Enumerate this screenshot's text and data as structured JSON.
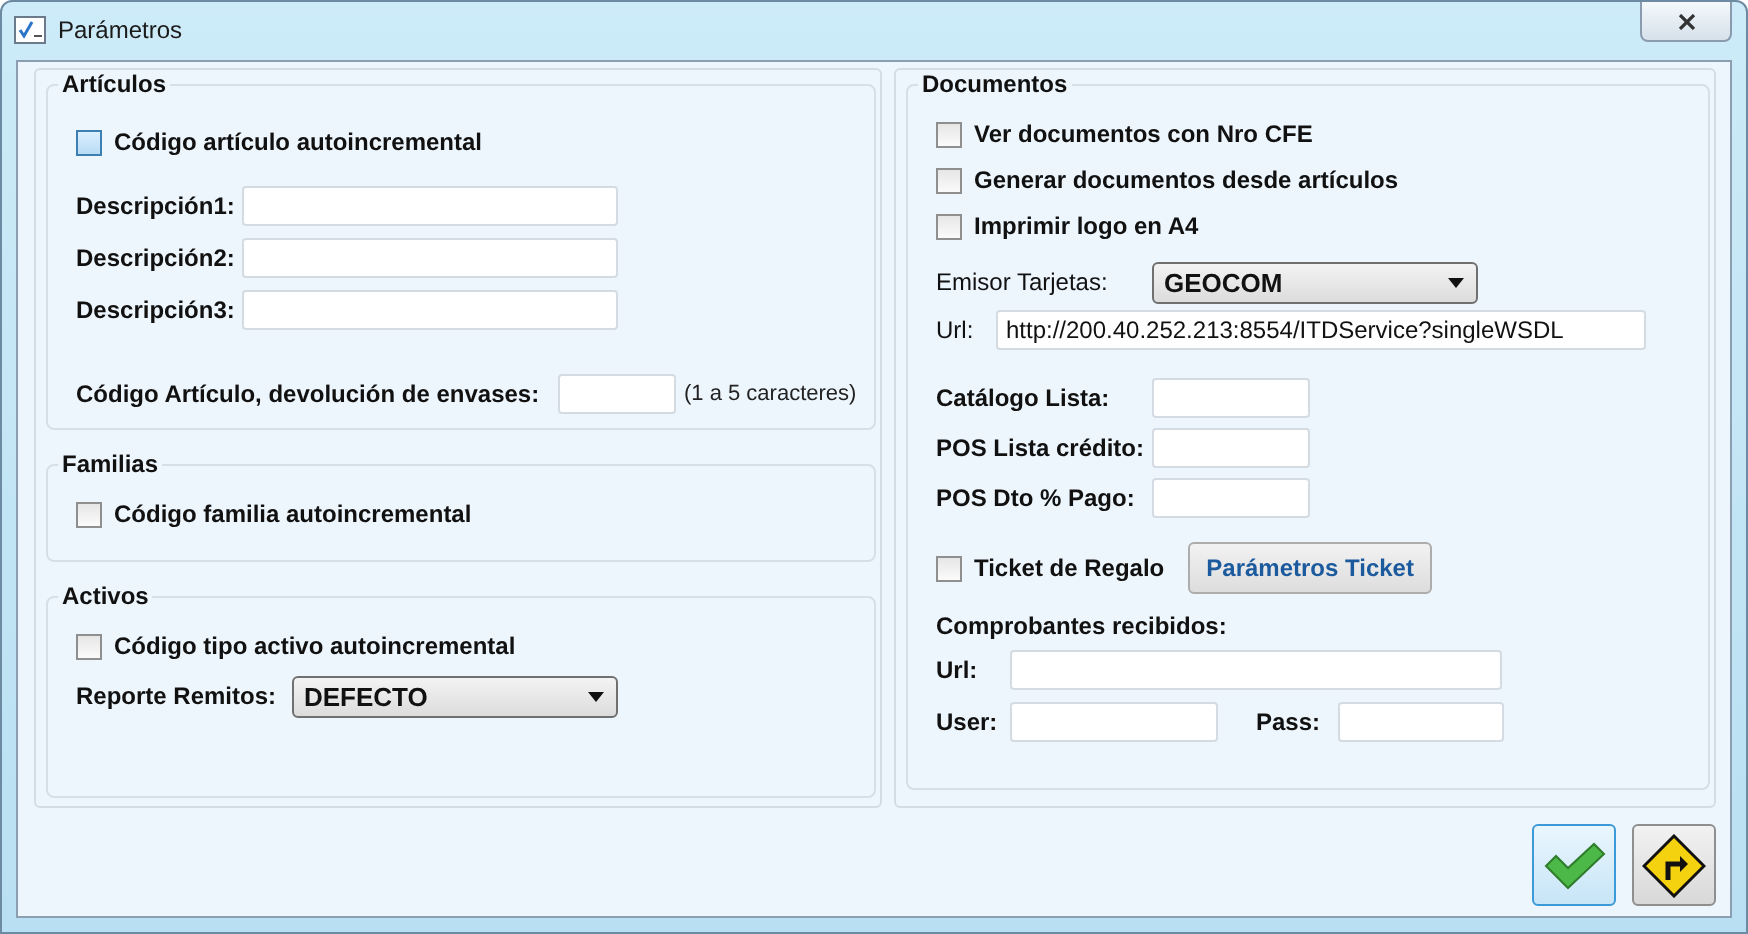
{
  "window": {
    "title": "Parámetros"
  },
  "articulos": {
    "title": "Artículos",
    "autoincrement": {
      "label": "Código artículo autoincremental",
      "checked": false,
      "focused": true
    },
    "fields": [
      {
        "label": "Descripción1:"
      },
      {
        "label": "Descripción2:"
      },
      {
        "label": "Descripción3:"
      }
    ],
    "return_code": {
      "label": "Código Artículo, devolución de envases:",
      "hint": "(1 a 5 caracteres)"
    }
  },
  "familias": {
    "title": "Familias",
    "autoincrement": {
      "label": "Código familia autoincremental",
      "checked": false,
      "focused": false
    }
  },
  "activos": {
    "title": "Activos",
    "autoincrement": {
      "label": "Código tipo activo autoincremental",
      "checked": false,
      "focused": false
    },
    "report": {
      "label": "Reporte Remitos:",
      "value": "DEFECTO"
    }
  },
  "documentos": {
    "title": "Documentos",
    "checkboxes": [
      {
        "label": "Ver documentos con Nro CFE",
        "checked": false,
        "focused": false
      },
      {
        "label": "Generar documentos desde artículos",
        "checked": false,
        "focused": false
      },
      {
        "label": "Imprimir logo en A4",
        "checked": false,
        "focused": false
      }
    ],
    "emisor": {
      "label": "Emisor Tarjetas:",
      "value": "GEOCOM"
    },
    "url": {
      "label": "Url:",
      "value": "http://200.40.252.213:8554/ITDService?singleWSDL"
    },
    "fields": [
      {
        "label": "Catálogo Lista:"
      },
      {
        "label": "POS Lista crédito:"
      },
      {
        "label": "POS Dto % Pago:"
      }
    ],
    "gift": {
      "label": "Ticket de Regalo",
      "checked": false,
      "focused": false
    },
    "ticket_button": "Parámetros Ticket",
    "received": {
      "title": "Comprobantes recibidos:",
      "url_label": "Url:",
      "user_label": "User:",
      "pass_label": "Pass:"
    }
  }
}
